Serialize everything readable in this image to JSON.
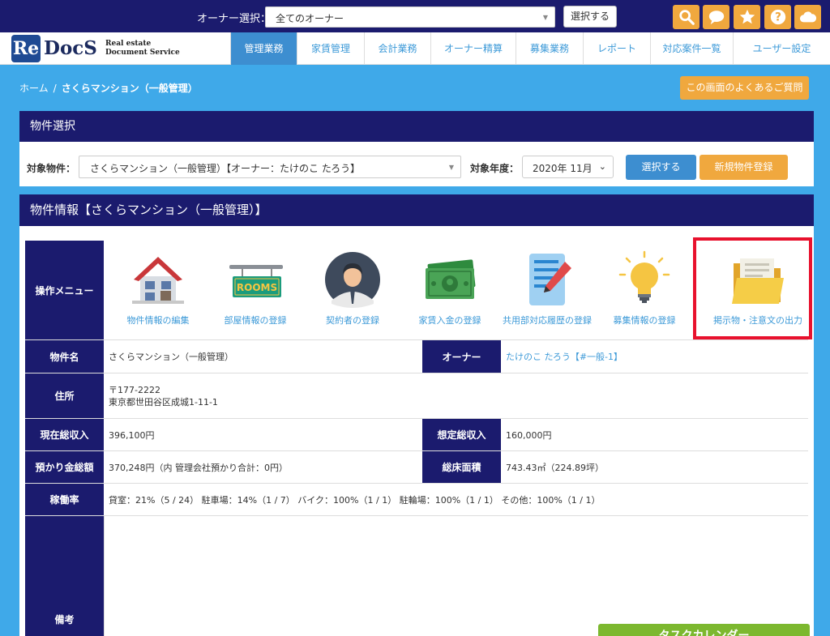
{
  "topbar": {
    "owner_label": "オーナー選択：",
    "owner_value": "全てのオーナー",
    "select_button": "選択する",
    "icons": [
      "search-icon",
      "chat-icon",
      "star-icon",
      "help-icon",
      "cloud-icon"
    ],
    "accent_color": "#f0a83e"
  },
  "logo": {
    "re": "Re",
    "docs": "DocS",
    "line1": "Real estate",
    "line2": "Document Service"
  },
  "nav": {
    "items": [
      {
        "label": "管理業務",
        "active": true
      },
      {
        "label": "家賃管理",
        "active": false
      },
      {
        "label": "会計業務",
        "active": false
      },
      {
        "label": "オーナー精算",
        "active": false
      },
      {
        "label": "募集業務",
        "active": false
      },
      {
        "label": "レポート",
        "active": false
      },
      {
        "label": "対応案件一覧",
        "active": false
      },
      {
        "label": "ユーザー設定",
        "active": false
      }
    ]
  },
  "breadcrumb": {
    "home": "ホーム",
    "sep": "/",
    "current": "さくらマンション（一般管理）"
  },
  "faq_button": "この画面のよくあるご質問",
  "property_select": {
    "title": "物件選択",
    "property_label": "対象物件：",
    "property_value": "さくらマンション（一般管理）【オーナー：たけのこ たろう】",
    "year_label": "対象年度：",
    "year_value": "2020年 11月",
    "select_button": "選択する",
    "new_button": "新規物件登録"
  },
  "property_info": {
    "title": "物件情報【さくらマンション（一般管理）】",
    "menu_label": "操作メニュー",
    "menu": [
      {
        "label": "物件情報の編集",
        "icon": "house-icon"
      },
      {
        "label": "部屋情報の登録",
        "icon": "rooms-sign-icon"
      },
      {
        "label": "契約者の登録",
        "icon": "person-icon"
      },
      {
        "label": "家賃入金の登録",
        "icon": "money-icon"
      },
      {
        "label": "共用部対応履歴の登録",
        "icon": "notepad-icon"
      },
      {
        "label": "募集情報の登録",
        "icon": "lightbulb-icon"
      },
      {
        "label": "掲示物・注意文の出力",
        "icon": "folder-icon"
      }
    ],
    "name_label": "物件名",
    "name_value": "さくらマンション（一般管理）",
    "owner_label": "オーナー",
    "owner_value": "たけのこ たろう【#一般-1】",
    "address_label": "住所",
    "address_line1": "〒177-2222",
    "address_line2": "東京都世田谷区成城1-11-1",
    "current_income_label": "現在総収入",
    "current_income_value": "396,100円",
    "expected_income_label": "想定総収入",
    "expected_income_value": "160,000円",
    "deposit_label": "預かり金総額",
    "deposit_value": "370,248円（内 管理会社預かり合計：0円）",
    "floor_label": "総床面積",
    "floor_value": "743.43㎡（224.89坪）",
    "occupancy_label": "稼働率",
    "occupancy_value": "貸室：21%（5 / 24） 駐車場：14%（1 / 7） バイク：100%（1 / 1） 駐輪場：100%（1 / 1） その他：100%（1 / 1）",
    "notes_label": "備考"
  },
  "task_button": "タスクカレンダー"
}
